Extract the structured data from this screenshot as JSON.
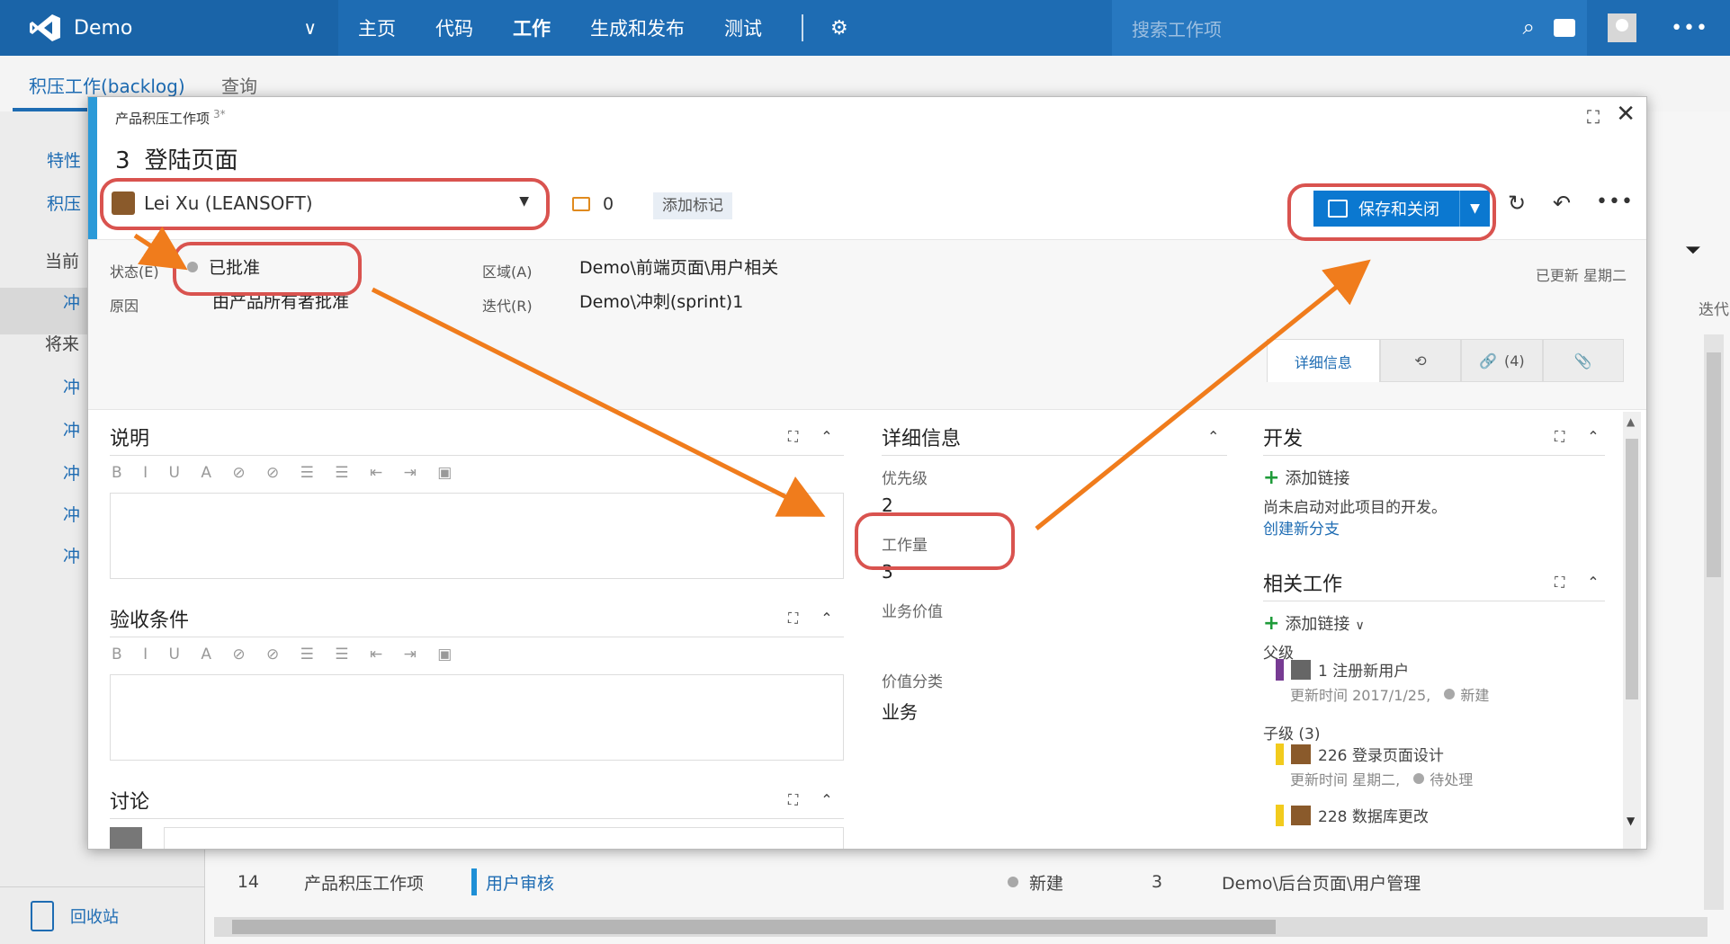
{
  "topnav": {
    "project": "Demo",
    "items": [
      "主页",
      "代码",
      "工作",
      "生成和发布",
      "测试"
    ],
    "active_index": 2,
    "search_placeholder": "搜索工作项"
  },
  "background": {
    "tabs": [
      "积压工作(backlog)",
      "查询"
    ],
    "left_items": [
      "特性",
      "积压",
      "当前",
      "冲",
      "将来",
      "冲",
      "冲",
      "冲",
      "冲",
      "冲"
    ],
    "recycle_bin": "回收站",
    "row": {
      "id": "14",
      "type": "产品积压工作项",
      "title": "用户审核",
      "state": "新建",
      "effort": "3",
      "area": "Demo\\后台页面\\用户管理"
    },
    "right_header": "迭代"
  },
  "dialog": {
    "type_label": "产品积压工作项",
    "type_count": "3*",
    "id": "3",
    "title": "登陆页面",
    "assignee": "Lei Xu (LEANSOFT)",
    "comment_count": "0",
    "add_tag": "添加标记",
    "save_close": "保存和关闭",
    "updated": "已更新 星期二",
    "fields": {
      "state_label": "状态(E)",
      "state_value": "已批准",
      "reason_label": "原因",
      "reason_value": "由产品所有者批准",
      "area_label": "区域(A)",
      "area_value": "Demo\\前端页面\\用户相关",
      "iteration_label": "迭代(R)",
      "iteration_value": "Demo\\冲刺(sprint)1"
    },
    "tabs": {
      "details": "详细信息",
      "links": "(4)"
    },
    "description_title": "说明",
    "acceptance_title": "验收条件",
    "discussion_title": "讨论",
    "details": {
      "title": "详细信息",
      "priority_label": "优先级",
      "priority_value": "2",
      "effort_label": "工作量",
      "effort_value": "3",
      "business_value_label": "业务价值",
      "value_area_label": "价值分类",
      "value_area_value": "业务"
    },
    "development": {
      "title": "开发",
      "add_link": "添加链接",
      "not_started": "尚未启动对此项目的开发。",
      "create_branch": "创建新分支"
    },
    "related": {
      "title": "相关工作",
      "add_link": "添加链接",
      "parent_label": "父级",
      "parent": {
        "text": "1 注册新用户",
        "meta": "更新时间 2017/1/25,",
        "state": "新建"
      },
      "children_label": "子级 (3)",
      "children": [
        {
          "text": "226 登录页面设计",
          "meta": "更新时间 星期二,",
          "state": "待处理"
        },
        {
          "text": "228 数据库更改"
        }
      ]
    }
  },
  "colors": {
    "nav": "#1e6cb3",
    "accent": "#2b9ad8",
    "annotation": "#f07c1c",
    "highlight": "#d9534f"
  }
}
